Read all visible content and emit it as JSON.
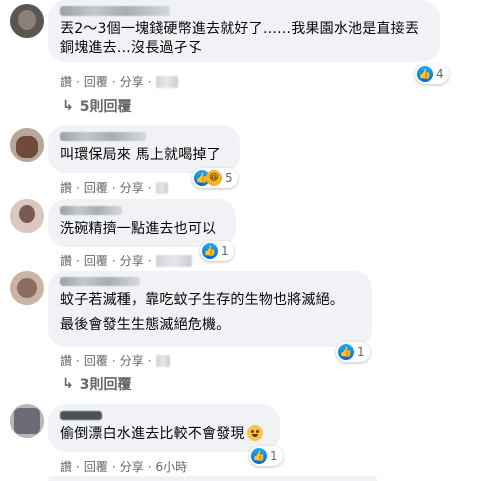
{
  "comments": [
    {
      "text_lines": [
        "丟2～3個一塊錢硬幣進去就好了……我果園水池是直接丟",
        "銅塊進去…沒長過孑孓"
      ],
      "reaction_count": "4",
      "reaction_icon": "like-icon",
      "actions": {
        "like": "讚",
        "reply": "回覆",
        "share": "分享"
      },
      "replies_label": "5則回覆"
    },
    {
      "text_lines": [
        "叫環保局來 馬上就喝掉了"
      ],
      "reaction_count": "5",
      "reaction_icon": "haha-icon",
      "actions": {
        "like": "讚",
        "reply": "回覆",
        "share": "分享"
      }
    },
    {
      "text_lines": [
        "洗碗精擠一點進去也可以"
      ],
      "reaction_count": "1",
      "reaction_icon": "like-icon",
      "actions": {
        "like": "讚",
        "reply": "回覆",
        "share": "分享"
      }
    },
    {
      "text_lines": [
        "蚊子若滅種，靠吃蚊子生存的生物也將滅絕。"
      ],
      "text_para2": "最後會發生生態滅絕危機。",
      "reaction_count": "1",
      "reaction_icon": "like-icon",
      "actions": {
        "like": "讚",
        "reply": "回覆",
        "share": "分享"
      },
      "replies_label": "3則回覆"
    },
    {
      "text_lines": [
        "偷倒漂白水進去比較不會發現"
      ],
      "text_emoji": "grimace-emoji",
      "reaction_count": "1",
      "reaction_icon": "like-icon",
      "actions": {
        "like": "讚",
        "reply": "回覆",
        "share": "分享",
        "time": "6小時"
      }
    }
  ],
  "colors": {
    "bubble": "#f0f2f5",
    "text": "#050505",
    "secondary": "#65676b",
    "like_blue": "#0062df",
    "haha_yellow": "#f7b125"
  },
  "dot": "·",
  "reply_arrow": "↳"
}
